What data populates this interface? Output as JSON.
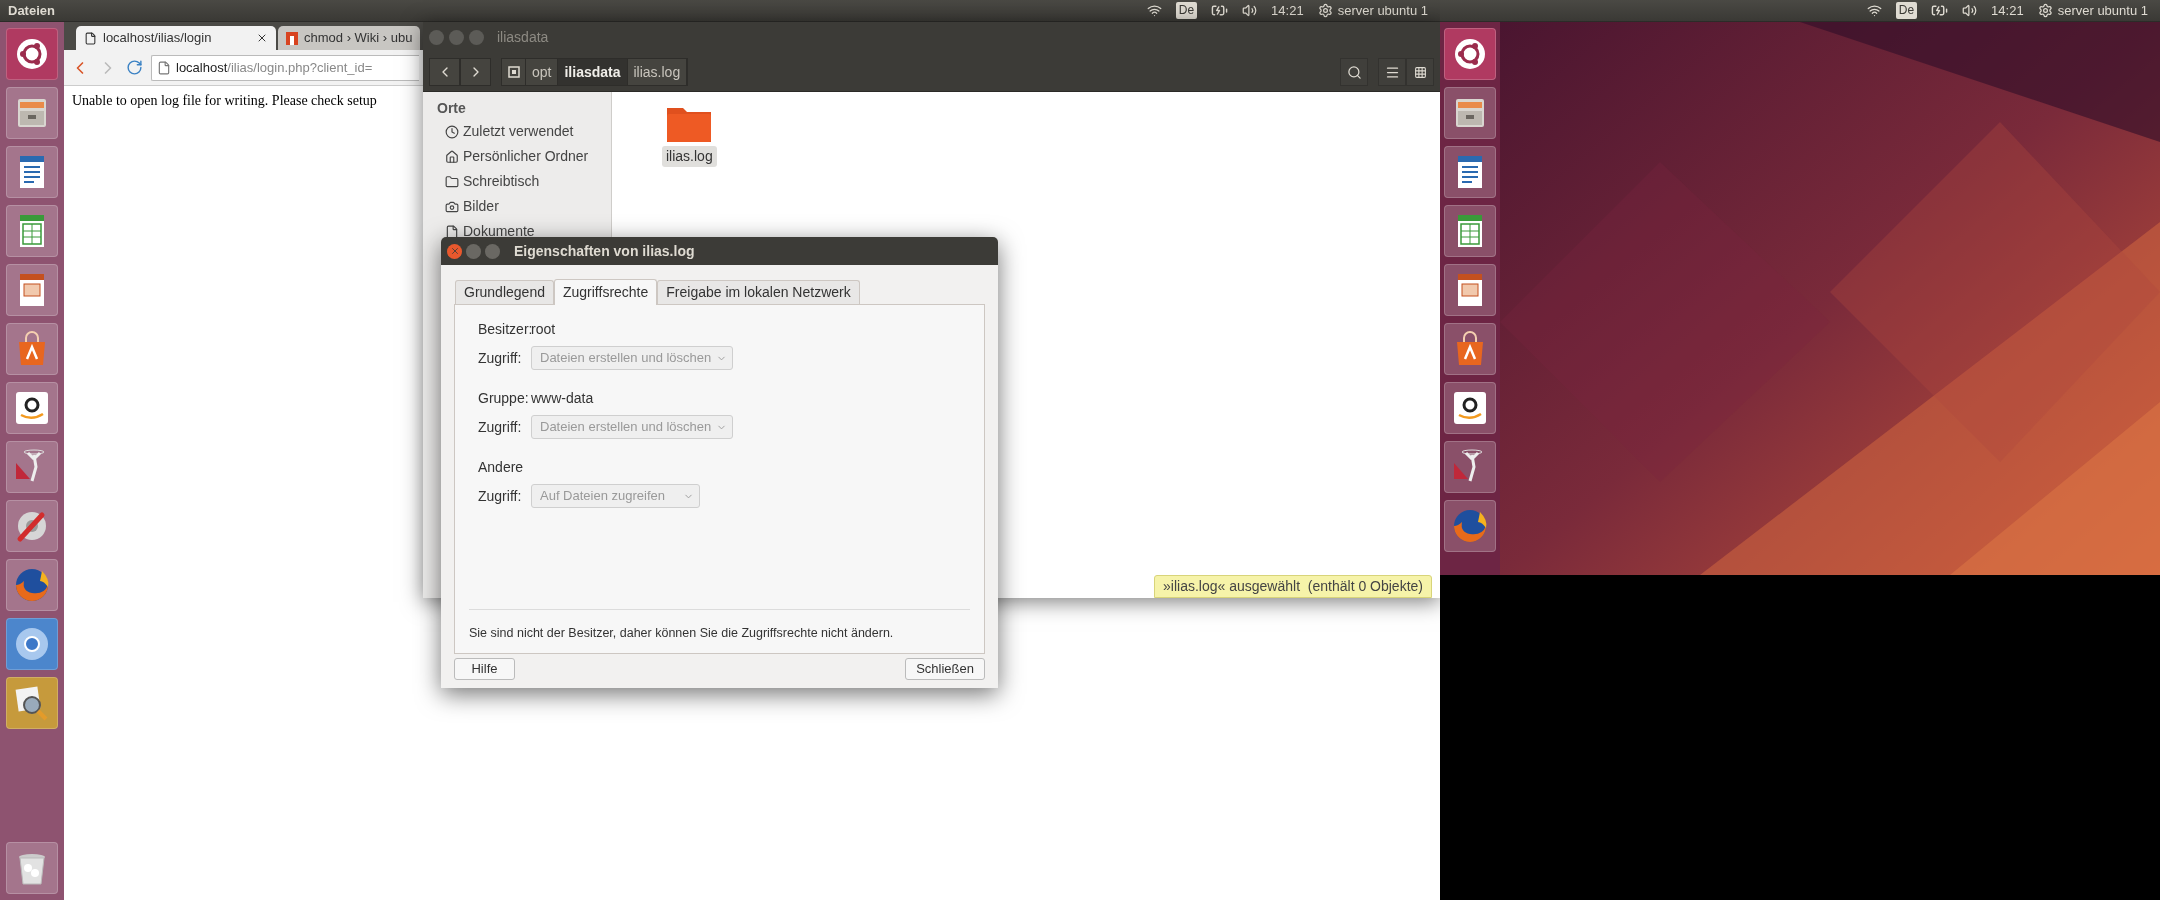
{
  "top_panels": [
    {
      "app_title": "Dateien",
      "keyboard_layout": "De",
      "time": "14:21",
      "session": "server ubuntu 1"
    },
    {
      "keyboard_layout": "De",
      "time": "14:21",
      "session": "server ubuntu 1"
    }
  ],
  "browser": {
    "tabs": [
      {
        "title": "localhost/ilias/login",
        "selected": true
      },
      {
        "title": "chmod › Wiki › ubu",
        "selected": false
      }
    ],
    "url": {
      "host": "localhost",
      "path": "/ilias/login.php?client_id="
    },
    "page_text": "Unable to open log file for writing. Please check setup"
  },
  "file_manager": {
    "title": "iliasdata",
    "path": [
      {
        "label": "opt",
        "selected": false
      },
      {
        "label": "iliasdata",
        "selected": true
      },
      {
        "label": "ilias.log",
        "selected": false
      }
    ],
    "sidebar": {
      "heading": "Orte",
      "items": [
        {
          "label": "Zuletzt verwendet",
          "kind": "recent"
        },
        {
          "label": "Persönlicher Ordner",
          "kind": "home"
        },
        {
          "label": "Schreibtisch",
          "kind": "folder"
        },
        {
          "label": "Bilder",
          "kind": "camera"
        },
        {
          "label": "Dokumente",
          "kind": "document"
        }
      ]
    },
    "files": [
      {
        "name": "ilias.log",
        "selected": true
      }
    ],
    "status": "»ilias.log« ausgewählt  (enthält 0 Objekte)"
  },
  "dialog": {
    "title": "Eigenschaften von ilias.log",
    "tabs": [
      {
        "label": "Grundlegend",
        "selected": false
      },
      {
        "label": "Zugriffsrechte",
        "selected": true
      },
      {
        "label": "Freigabe im lokalen Netzwerk",
        "selected": false
      }
    ],
    "sections": [
      {
        "label": "Besitzer:",
        "value": "root",
        "access_label": "Zugriff:",
        "access": "Dateien erstellen und löschen",
        "disabled": true
      },
      {
        "label": "Gruppe:",
        "value": "www-data",
        "access_label": "Zugriff:",
        "access": "Dateien erstellen und löschen",
        "disabled": true
      },
      {
        "label": "Andere",
        "access_label": "Zugriff:",
        "access": "Auf Dateien zugreifen",
        "disabled": true
      }
    ],
    "note": "Sie sind nicht der Besitzer, daher können Sie die Zugriffsrechte nicht ändern.",
    "buttons": [
      "Hilfe",
      "Schließen"
    ]
  }
}
